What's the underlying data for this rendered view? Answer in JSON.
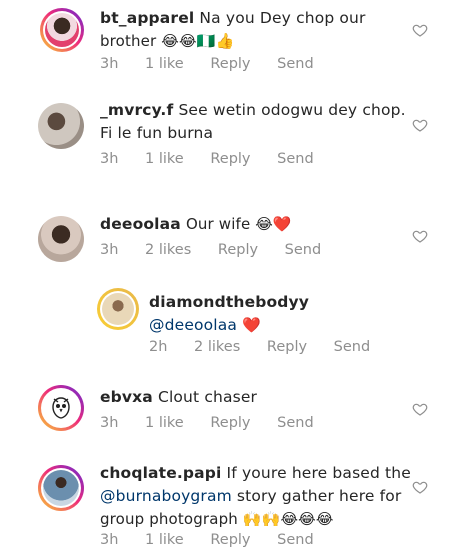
{
  "comments": [
    {
      "username": "bt_apparel",
      "lines": [
        "Na you Dey chop our",
        "brother 😂😂🇳🇬👍"
      ],
      "time": "3h",
      "likes": "1 like",
      "reply": "Reply",
      "send": "Send"
    },
    {
      "username": "_mvrcy.f",
      "lines": [
        "See wetin odogwu dey chop.",
        "Fi le fun burna"
      ],
      "time": "3h",
      "likes": "1 like",
      "reply": "Reply",
      "send": "Send"
    },
    {
      "username": "deeoolaa",
      "lines": [
        "Our wife 😂❤️"
      ],
      "time": "3h",
      "likes": "2 likes",
      "reply": "Reply",
      "send": "Send"
    },
    {
      "username": "diamondthebodyy",
      "mention": "@deeoolaa",
      "lines": [
        "❤️"
      ],
      "time": "2h",
      "likes": "2 likes",
      "reply": "Reply",
      "send": "Send"
    },
    {
      "username": "ebvxa",
      "lines": [
        "Clout chaser"
      ],
      "time": "3h",
      "likes": "1 like",
      "reply": "Reply",
      "send": "Send"
    },
    {
      "username": "choqlate.papi",
      "lines": [
        "If youre here based the"
      ],
      "mention": "@burnaboygram",
      "line2_rest": " story gather here for",
      "line3": "group photograph 🙌🙌😂😂😂",
      "time": "3h",
      "likes": "1 like",
      "reply": "Reply",
      "send": "Send"
    }
  ],
  "colors": {
    "text": "#262626",
    "meta": "#8e8e8e",
    "mention": "#00376b",
    "heart_outline": "#8e8e8e"
  },
  "icons": {
    "like": "heart-outline-icon",
    "owl": "owl-logo-icon"
  }
}
